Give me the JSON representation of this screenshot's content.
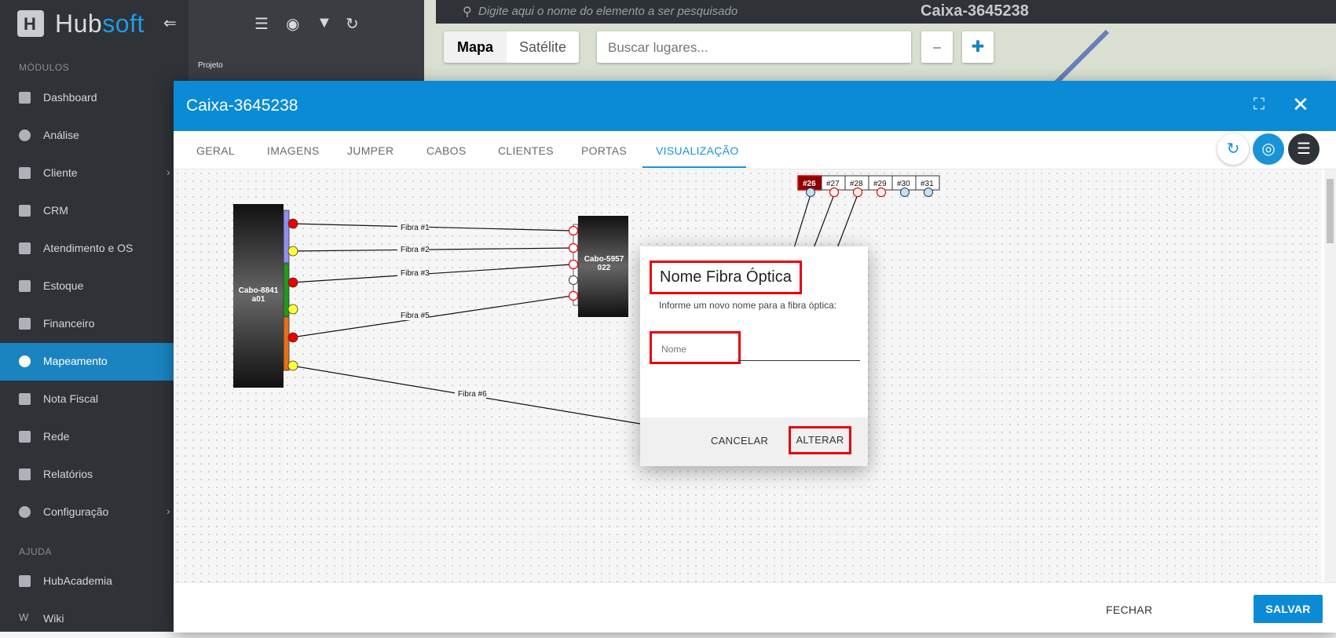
{
  "sidebar": {
    "brand": "Hubsoft",
    "brand_hub": "Hub",
    "brand_soft": "soft",
    "modules_header": "MÓDULOS",
    "help_header": "AJUDA",
    "items": [
      {
        "label": "Dashboard",
        "icon": "dashboard-icon"
      },
      {
        "label": "Análise",
        "icon": "pie-chart-icon"
      },
      {
        "label": "Cliente",
        "icon": "contact-card-icon"
      },
      {
        "label": "CRM",
        "icon": "board-icon"
      },
      {
        "label": "Atendimento e OS",
        "icon": "calendar-clock-icon"
      },
      {
        "label": "Estoque",
        "icon": "box-icon"
      },
      {
        "label": "Financeiro",
        "icon": "money-icon"
      },
      {
        "label": "Mapeamento",
        "icon": "map-pin-icon",
        "active": true
      },
      {
        "label": "Nota Fiscal",
        "icon": "invoice-icon"
      },
      {
        "label": "Rede",
        "icon": "server-icon"
      },
      {
        "label": "Relatórios",
        "icon": "report-icon"
      },
      {
        "label": "Configuração",
        "icon": "gear-icon"
      }
    ],
    "help_items": [
      {
        "label": "HubAcademia",
        "icon": "play-icon"
      },
      {
        "label": "Wiki",
        "icon": "wiki-icon"
      }
    ]
  },
  "panel": {
    "project_label": "Projeto"
  },
  "map": {
    "search_placeholder": "Digite aqui o nome do elemento a ser pesquisado",
    "element_title": "Caixa-3645238",
    "type_map": "Mapa",
    "type_satellite": "Satélite",
    "places_placeholder": "Buscar lugares..."
  },
  "modal": {
    "title": "Caixa-3645238",
    "tabs": [
      "GERAL",
      "IMAGENS",
      "JUMPER",
      "CABOS",
      "CLIENTES",
      "PORTAS",
      "VISUALIZAÇÃO"
    ],
    "active_tab": "VISUALIZAÇÃO",
    "close_label": "FECHAR",
    "save_label": "SALVAR"
  },
  "diagram": {
    "cable_left": "Cabo-8841a01",
    "cable_left_l1": "Cabo-8841",
    "cable_left_l2": "a01",
    "cable_right_l1": "Cabo-5957",
    "cable_right_l2": "022",
    "fibers": [
      "Fibra #1",
      "Fibra #2",
      "Fibra #3",
      "Fibra #5",
      "Fibra #6"
    ],
    "ports": [
      "#26",
      "#27",
      "#28",
      "#29",
      "#30",
      "#31"
    ]
  },
  "dialog": {
    "title": "Nome Fibra Óptica",
    "message": "Informe um novo nome para a fibra óptica:",
    "input_placeholder": "Nome",
    "cancel_label": "CANCELAR",
    "confirm_label": "ALTERAR"
  },
  "colors": {
    "primary": "#0b8bd6",
    "sidebar_bg": "#2f3237",
    "active_item": "#1a84c1",
    "highlight": "#e8000b",
    "port_active": "#8b0000"
  }
}
